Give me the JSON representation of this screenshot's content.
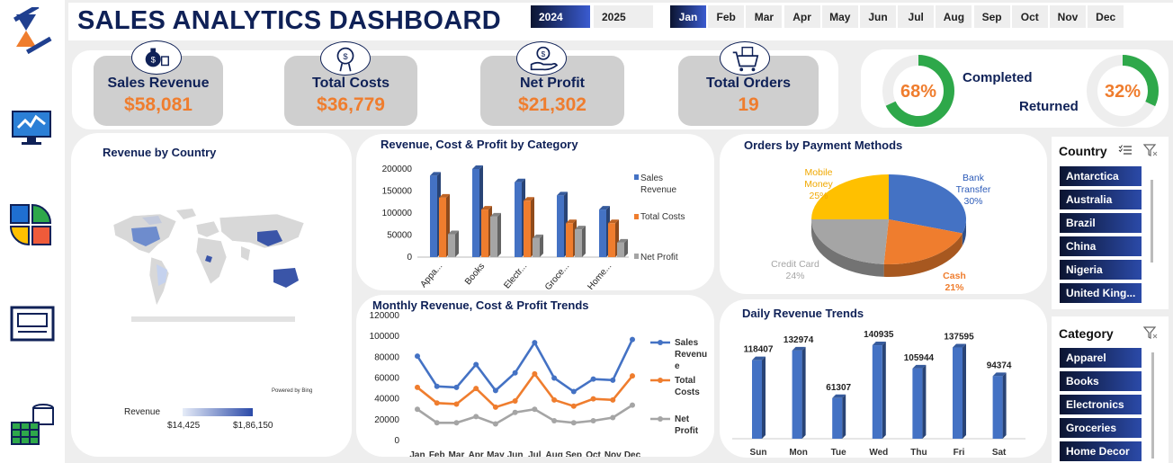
{
  "dashboard": {
    "title": "SALES ANALYTICS DASHBOARD"
  },
  "years": [
    {
      "label": "2024",
      "selected": true
    },
    {
      "label": "2025",
      "selected": false
    }
  ],
  "months": [
    {
      "label": "Jan",
      "selected": true
    },
    {
      "label": "Feb"
    },
    {
      "label": "Mar"
    },
    {
      "label": "Apr"
    },
    {
      "label": "May"
    },
    {
      "label": "Jun"
    },
    {
      "label": "Jul"
    },
    {
      "label": "Aug"
    },
    {
      "label": "Sep"
    },
    {
      "label": "Oct"
    },
    {
      "label": "Nov"
    },
    {
      "label": "Dec"
    }
  ],
  "kpis": {
    "revenue": {
      "label": "Sales Revenue",
      "value": "$58,081"
    },
    "costs": {
      "label": "Total Costs",
      "value": "$36,779"
    },
    "profit": {
      "label": "Net Profit",
      "value": "$21,302"
    },
    "orders": {
      "label": "Total Orders",
      "value": "19"
    }
  },
  "status": {
    "completed": {
      "label": "Completed",
      "value": "68%",
      "fraction": 0.68
    },
    "returned": {
      "label": "Returned",
      "value": "32%",
      "fraction": 0.32
    }
  },
  "map": {
    "title": "Revenue by Country",
    "legend_label": "Revenue",
    "min": "$14,425",
    "max": "$1,86,150",
    "credit": "Powered by Bing"
  },
  "slicers": {
    "country": {
      "title": "Country",
      "items": [
        "Antarctica",
        "Australia",
        "Brazil",
        "China",
        "Nigeria",
        "United King..."
      ]
    },
    "category": {
      "title": "Category",
      "items": [
        "Apparel",
        "Books",
        "Electronics",
        "Groceries",
        "Home Decor"
      ]
    }
  },
  "colors": {
    "navy": "#0f2157",
    "orange": "#ef7d2e",
    "blue": "#4472c4",
    "gray": "#a5a5a5",
    "yellow": "#ffc000",
    "green": "#2ea84a"
  },
  "chart_data": [
    {
      "type": "bar",
      "title": "Revenue, Cost &  Profit by Category",
      "categories": [
        "Appa...",
        "Books",
        "Electr...",
        "Groce...",
        "Home..."
      ],
      "series": [
        {
          "name": "Sales Revenue",
          "values": [
            185000,
            200000,
            170000,
            140000,
            108000
          ]
        },
        {
          "name": "Total Costs",
          "values": [
            135000,
            108000,
            128000,
            77000,
            77000
          ]
        },
        {
          "name": "Net Profit",
          "values": [
            52000,
            92000,
            43000,
            63000,
            33000
          ]
        }
      ],
      "ylim": [
        0,
        200000
      ],
      "yticks": [
        "200000",
        "150000",
        "100000",
        "50000",
        "0"
      ]
    },
    {
      "type": "pie",
      "title": "Orders by Payment Methods",
      "slices": [
        {
          "name": "Bank Transfer",
          "label": "Bank Transfer",
          "value": 30,
          "pct": "30%"
        },
        {
          "name": "Cash",
          "label": "Cash",
          "value": 21,
          "pct": "21%"
        },
        {
          "name": "Credit Card",
          "label": "Credit Card",
          "value": 24,
          "pct": "24%"
        },
        {
          "name": "Mobile Money",
          "label": "Mobile Money",
          "value": 25,
          "pct": "25%"
        }
      ]
    },
    {
      "type": "line",
      "title": "Monthly Revenue, Cost & Profit Trends",
      "categories": [
        "Jan",
        "Feb",
        "Mar",
        "Apr",
        "May",
        "Jun",
        "Jul",
        "Aug",
        "Sep",
        "Oct",
        "Nov",
        "Dec"
      ],
      "series": [
        {
          "name": "Sales Revenue",
          "values": [
            81000,
            52000,
            51000,
            73000,
            48000,
            65000,
            94000,
            60000,
            47000,
            59000,
            58000,
            97000
          ]
        },
        {
          "name": "Total Costs",
          "values": [
            51000,
            36000,
            35000,
            50000,
            32000,
            38000,
            64000,
            39000,
            33000,
            40000,
            39000,
            62000
          ]
        },
        {
          "name": "Net Profit",
          "values": [
            30000,
            17000,
            17000,
            23000,
            16000,
            27000,
            30000,
            19000,
            17000,
            19000,
            22000,
            34000
          ]
        }
      ],
      "ylim": [
        0,
        120000
      ],
      "yticks": [
        "120000",
        "100000",
        "80000",
        "60000",
        "40000",
        "20000",
        "0"
      ]
    },
    {
      "type": "bar",
      "title": "Daily Revenue Trends",
      "categories": [
        "Sun",
        "Mon",
        "Tue",
        "Wed",
        "Thu",
        "Fri",
        "Sat"
      ],
      "values": [
        118407,
        132974,
        61307,
        140935,
        105944,
        137595,
        94374
      ],
      "labels": [
        "118407",
        "132974",
        "61307",
        "140935",
        "105944",
        "137595",
        "94374"
      ],
      "ylim": [
        0,
        160000
      ]
    }
  ]
}
